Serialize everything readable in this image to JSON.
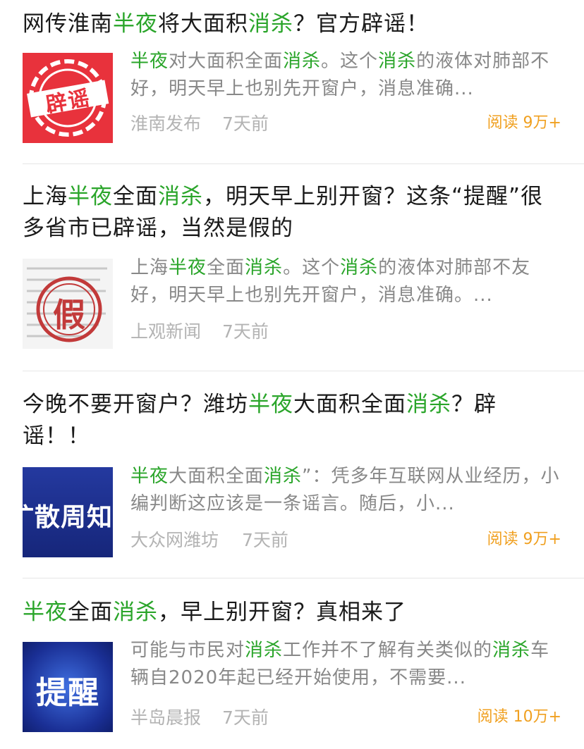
{
  "colors": {
    "highlight": "#2aa52a",
    "reads": "#f0a020",
    "meta": "#b3b3b3",
    "snippet": "#888888"
  },
  "articles": [
    {
      "title": [
        {
          "t": "网传淮南",
          "h": false
        },
        {
          "t": "半夜",
          "h": true
        },
        {
          "t": "将大面积",
          "h": false
        },
        {
          "t": "消杀",
          "h": true
        },
        {
          "t": "？官方辟谣！",
          "h": false
        }
      ],
      "snippet": [
        {
          "t": "半夜",
          "h": true
        },
        {
          "t": "对大面积全面",
          "h": false
        },
        {
          "t": "消杀",
          "h": true
        },
        {
          "t": "。这个",
          "h": false
        },
        {
          "t": "消杀",
          "h": true
        },
        {
          "t": "的液体对肺部不好，明天早上也别先开窗户，消息准确...",
          "h": false
        }
      ],
      "source": "淮南发布",
      "age": "7天前",
      "reads": "阅读 9万+",
      "thumb_text": "辟谣",
      "thumb_icon": "stamp-rumor-icon"
    },
    {
      "title": [
        {
          "t": "上海",
          "h": false
        },
        {
          "t": "半夜",
          "h": true
        },
        {
          "t": "全面",
          "h": false
        },
        {
          "t": "消杀",
          "h": true
        },
        {
          "t": "，明天早上别开窗？这条“提醒”很多省市已辟谣，当然是假的",
          "h": false
        }
      ],
      "snippet": [
        {
          "t": "上海",
          "h": false
        },
        {
          "t": "半夜",
          "h": true
        },
        {
          "t": "全面",
          "h": false
        },
        {
          "t": "消杀",
          "h": true
        },
        {
          "t": "。这个",
          "h": false
        },
        {
          "t": "消杀",
          "h": true
        },
        {
          "t": "的液体对肺部不友好，明天早上也别先开窗户，消息准确。...",
          "h": false
        }
      ],
      "source": "上观新闻",
      "age": "7天前",
      "reads": "",
      "thumb_text": "假",
      "thumb_icon": "fake-stamp-icon"
    },
    {
      "title": [
        {
          "t": "今晚不要开窗户？潍坊",
          "h": false
        },
        {
          "t": "半夜",
          "h": true
        },
        {
          "t": "大面积全面",
          "h": false
        },
        {
          "t": "消杀",
          "h": true
        },
        {
          "t": "？辟谣！！",
          "h": false
        }
      ],
      "snippet": [
        {
          "t": "半夜",
          "h": true
        },
        {
          "t": "大面积全面",
          "h": false
        },
        {
          "t": "消杀",
          "h": true
        },
        {
          "t": "”：凭多年互联网从业经历，小编判断这应该是一条谣言。随后，小...",
          "h": false
        }
      ],
      "source": "大众网潍坊",
      "age": "7天前",
      "reads": "阅读 9万+",
      "thumb_text": "扩散周知",
      "thumb_icon": "notice-banner-icon"
    },
    {
      "title": [
        {
          "t": "半夜",
          "h": true
        },
        {
          "t": "全面",
          "h": false
        },
        {
          "t": "消杀",
          "h": true
        },
        {
          "t": "，早上别开窗？真相来了",
          "h": false
        }
      ],
      "snippet": [
        {
          "t": "可能与市民对",
          "h": false
        },
        {
          "t": "消杀",
          "h": true
        },
        {
          "t": "工作并不了解有关类似的",
          "h": false
        },
        {
          "t": "消杀",
          "h": true
        },
        {
          "t": "车辆自2020年起已经开始使用，不需要...",
          "h": false
        }
      ],
      "source": "半岛晨报",
      "age": "7天前",
      "reads": "阅读 10万+",
      "thumb_text": "提醒",
      "thumb_icon": "reminder-banner-icon"
    }
  ]
}
